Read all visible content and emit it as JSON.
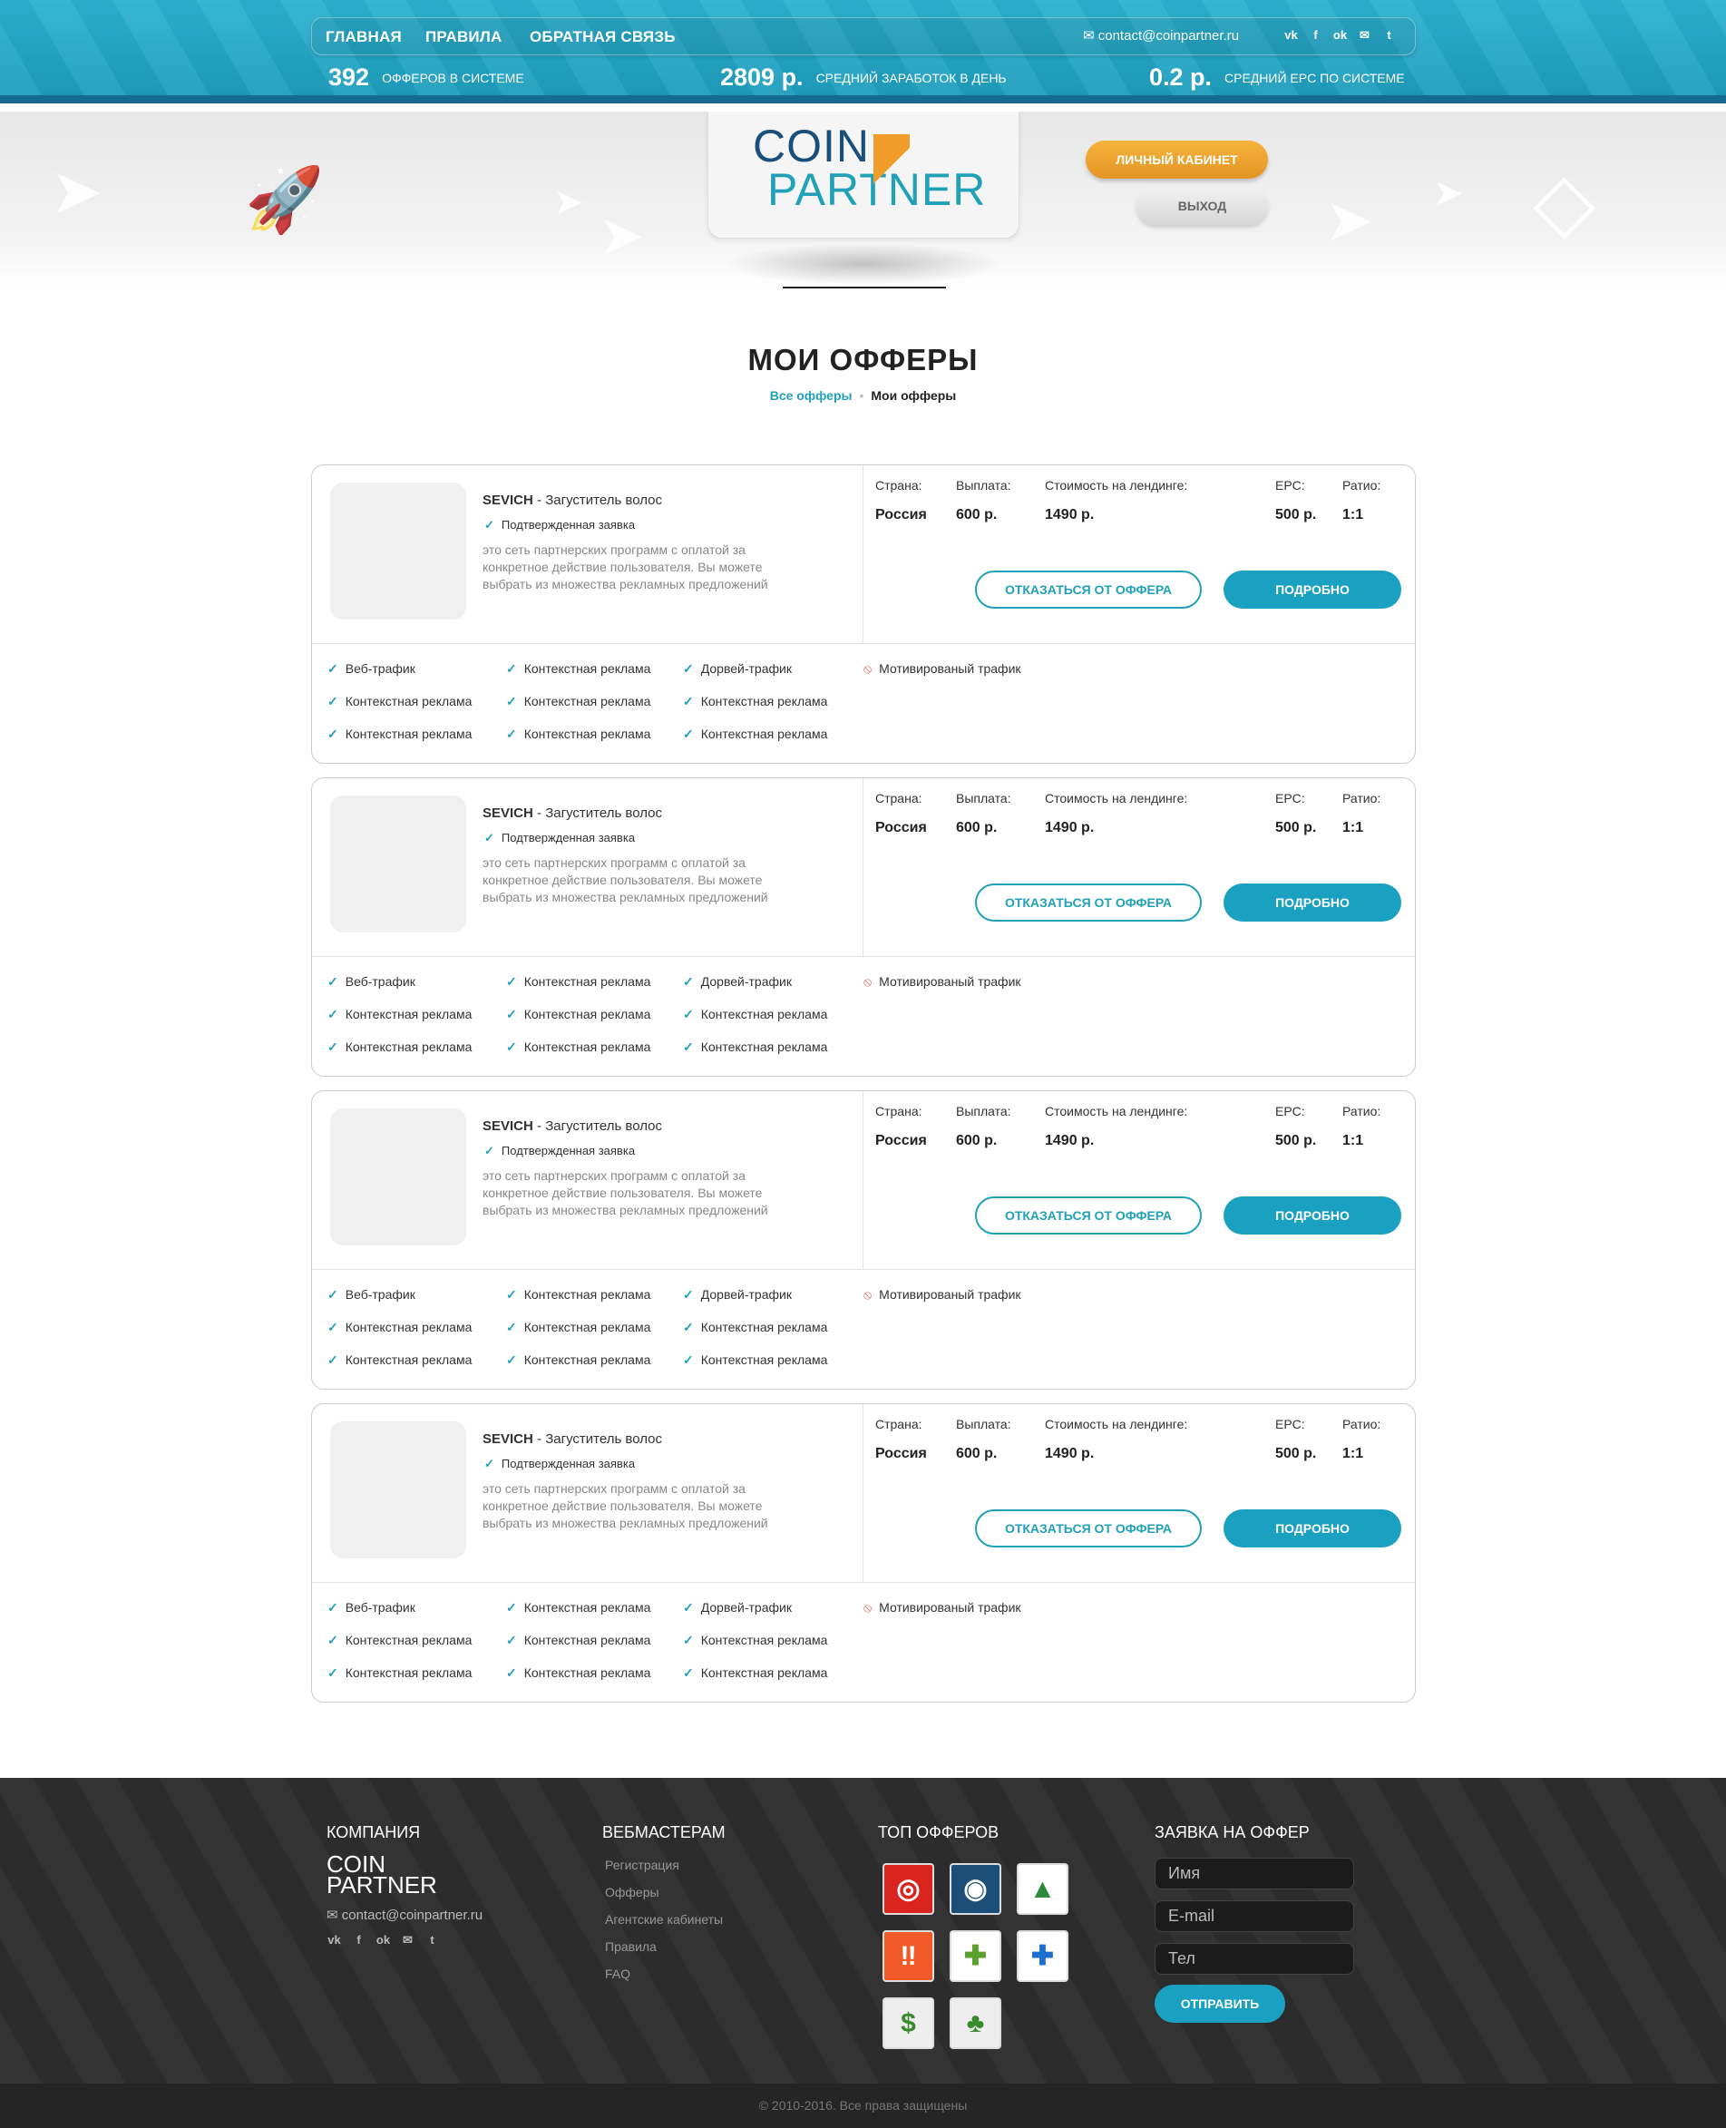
{
  "nav": {
    "items": [
      "ГЛАВНАЯ",
      "ПРАВИЛА",
      "ОБРАТНАЯ СВЯЗЬ"
    ],
    "email": "contact@coinpartner.ru",
    "social": [
      "vk-icon",
      "facebook-icon",
      "odnoklassniki-icon",
      "mail-icon",
      "twitter-icon"
    ],
    "mail_icon": "✉"
  },
  "stats": [
    {
      "value": "392",
      "label": "ОФФЕРОВ В СИСТЕМЕ"
    },
    {
      "value": "2809 р.",
      "label": "СРЕДНИЙ ЗАРАБОТОК В ДЕНЬ"
    },
    {
      "value": "0.2 р.",
      "label": "СРЕДНИЙ EPC ПО СИСТЕМЕ"
    }
  ],
  "logo": {
    "line1": "COIN",
    "line2": "PARTNER"
  },
  "header_buttons": {
    "cabinet": "ЛИЧНЫЙ КАБИНЕТ",
    "exit": "ВЫХОД"
  },
  "page": {
    "title": "МОИ ОФФЕРЫ",
    "breadcrumb": {
      "link": "Все офферы",
      "current": "Мои офферы"
    }
  },
  "offer": {
    "brand": "SEVICH",
    "title_rest": " - Загуститель волос",
    "confirmed": "Подтвержденная заявка",
    "description": "это сеть партнерских программ с оплатой за конкретное действие пользователя. Вы можете выбрать из множества рекламных предложений",
    "labels": {
      "country": "Страна:",
      "payout": "Выплата:",
      "landing_cost": "Стоимость на лендинге:",
      "epc": "EPC:",
      "ratio": "Ратио:"
    },
    "values": {
      "country": "Россия",
      "payout": "600 р.",
      "landing_cost": "1490 р.",
      "epc": "500 р.",
      "ratio": "1:1"
    },
    "refuse_button": "ОТКАЗАТЬСЯ ОТ ОФФЕРА",
    "details_button": "ПОДРОБНО",
    "features": [
      {
        "label": "Веб-трафик",
        "allowed": true
      },
      {
        "label": "Контекстная реклама",
        "allowed": true
      },
      {
        "label": "Дорвей-трафик",
        "allowed": true
      },
      {
        "label": "Мотивированый трафик",
        "allowed": false
      },
      {
        "label": "Контекстная реклама",
        "allowed": true
      },
      {
        "label": "Контекстная реклама",
        "allowed": true
      },
      {
        "label": "Контекстная реклама",
        "allowed": true
      },
      {
        "label": "Контекстная реклама",
        "allowed": true
      },
      {
        "label": "Контекстная реклама",
        "allowed": true
      },
      {
        "label": "Контекстная реклама",
        "allowed": true
      }
    ],
    "count": 4
  },
  "footer": {
    "company_heading": "КОМПАНИЯ",
    "webmasters_heading": "ВЕБМАСТЕРАМ",
    "top_heading": "ТОП ОФФЕРОВ",
    "request_heading": "ЗАЯВКА НА ОФФЕР",
    "email": "contact@coinpartner.ru",
    "links": [
      "Регистрация",
      "Офферы",
      "Агентские кабинеты",
      "Правила",
      "FAQ"
    ],
    "tiles": [
      "car-logo-icon",
      "steam-icon",
      "chart-icon",
      "footprints-icon",
      "puzzle-green-icon",
      "puzzle-blue-icon",
      "money-tree-icon",
      "tree-icon"
    ],
    "form": {
      "name_placeholder": "Имя",
      "email_placeholder": "E-mail",
      "phone_placeholder": "Тел",
      "submit": "ОТПРАВИТЬ"
    },
    "copyright": "© 2010-2016. Все права защищены"
  },
  "colors": {
    "accent": "#1aa1c1",
    "orange": "#f19d2c",
    "dark_blue": "#1a4f7c"
  }
}
